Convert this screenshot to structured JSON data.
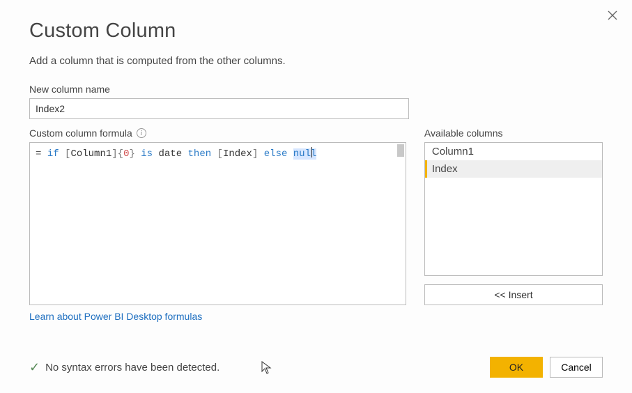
{
  "header": {
    "title": "Custom Column",
    "subtitle": "Add a column that is computed from the other columns."
  },
  "new_column": {
    "label": "New column name",
    "value": "Index2"
  },
  "formula": {
    "label": "Custom column formula",
    "equals": "=",
    "tokens": {
      "if": "if",
      "col1_open": "[",
      "col1": "Column1",
      "col1_close": "]",
      "brace_open": "{",
      "zero": "0",
      "brace_close": "}",
      "is": "is",
      "date": "date",
      "then": "then",
      "idx_open": "[",
      "idx": "Index",
      "idx_close": "]",
      "else": "else",
      "null": "null"
    }
  },
  "available": {
    "label": "Available columns",
    "items": [
      "Column1",
      "Index"
    ],
    "selected_index": 1,
    "insert_label": "<< Insert"
  },
  "link": {
    "text": "Learn about Power BI Desktop formulas"
  },
  "status": {
    "text": "No syntax errors have been detected."
  },
  "buttons": {
    "ok": "OK",
    "cancel": "Cancel"
  }
}
